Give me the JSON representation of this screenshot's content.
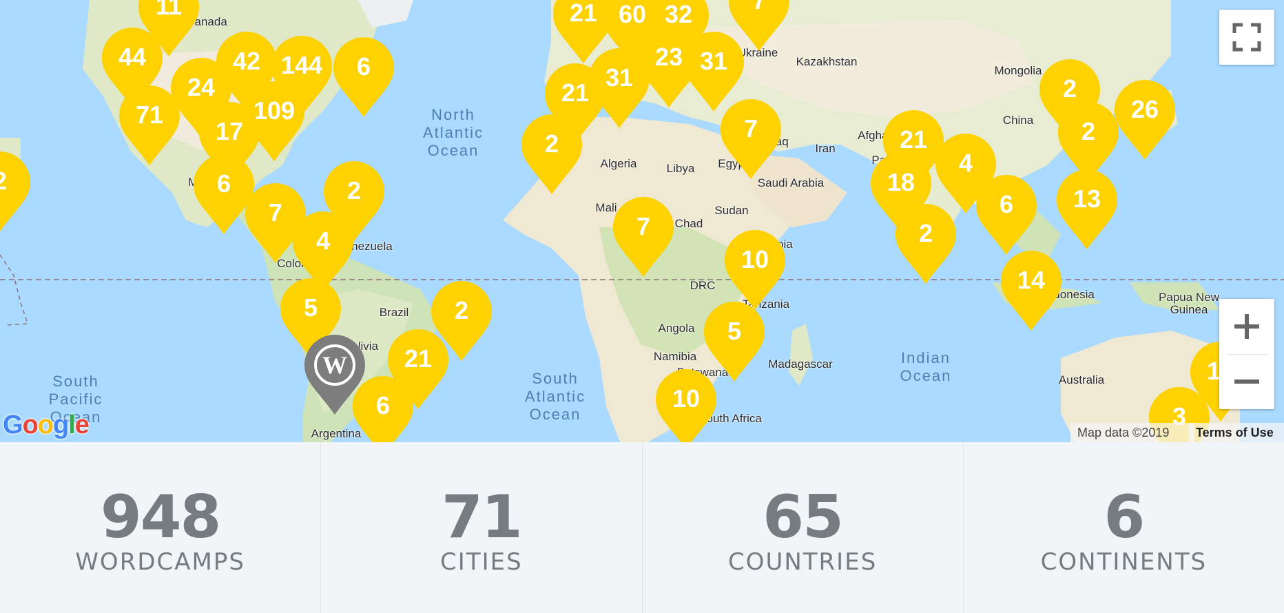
{
  "map": {
    "country_labels": [
      "Canada",
      "Kazakhstan",
      "Mongolia",
      "China",
      "Afghanistan",
      "Iran",
      "Pakistan",
      "Algeria",
      "Libya",
      "Egypt",
      "Saudi Arabia",
      "Mali",
      "Chad",
      "Sudan",
      "Ethiopia",
      "DRC",
      "Tanzania",
      "Angola",
      "Namibia",
      "Botswana",
      "Madagascar",
      "Brazil",
      "Bolivia",
      "Venezuela",
      "Colombia",
      "Mexico",
      "Ukraine",
      "Iraq",
      "Indonesia",
      "Papua New Guinea",
      "Australia",
      "Argentina",
      "South Africa"
    ],
    "ocean_labels": [
      "North\nAtlantic\nOcean",
      "South\nAtlantic\nOcean",
      "South\nPacific\nOcean",
      "Indian\nOcean"
    ],
    "marker_counts": [
      "11",
      "44",
      "71",
      "24",
      "42",
      "144",
      "109",
      "17",
      "6",
      "6",
      "7",
      "2",
      "4",
      "5",
      "2",
      "21",
      "6",
      "21",
      "60",
      "32",
      "7",
      "31",
      "23",
      "31",
      "21",
      "2",
      "7",
      "7",
      "21",
      "18",
      "4",
      "6",
      "2",
      "2",
      "26",
      "2",
      "13",
      "14",
      "10",
      "5",
      "10",
      "10",
      "3",
      "2"
    ],
    "marker_color": "#fdd200",
    "wordpress_marker": "wordpress-logo-icon",
    "google_logo": "Google",
    "map_data": "Map data ©2019",
    "terms": "Terms of Use",
    "zoom_in": "+",
    "zoom_out": "−"
  },
  "stats": [
    {
      "value": "948",
      "label": "WORDCAMPS"
    },
    {
      "value": "71",
      "label": "CITIES"
    },
    {
      "value": "65",
      "label": "COUNTRIES"
    },
    {
      "value": "6",
      "label": "CONTINENTS"
    }
  ]
}
